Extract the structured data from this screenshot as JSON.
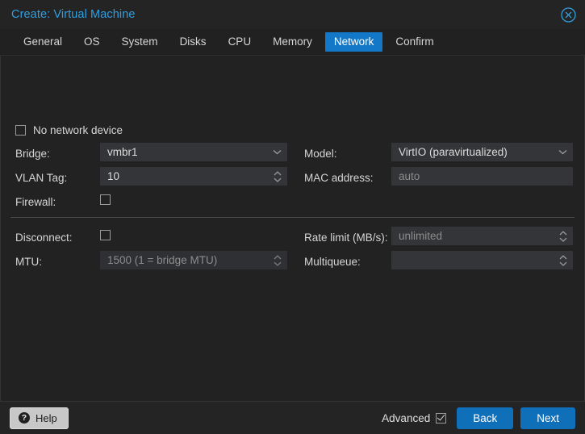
{
  "window": {
    "title": "Create: Virtual Machine",
    "close_icon": "close-circle-icon"
  },
  "tabs": [
    {
      "label": "General",
      "active": false
    },
    {
      "label": "OS",
      "active": false
    },
    {
      "label": "System",
      "active": false
    },
    {
      "label": "Disks",
      "active": false
    },
    {
      "label": "CPU",
      "active": false
    },
    {
      "label": "Memory",
      "active": false
    },
    {
      "label": "Network",
      "active": true
    },
    {
      "label": "Confirm",
      "active": false
    }
  ],
  "form": {
    "no_network_device": {
      "label": "No network device",
      "checked": false
    },
    "basic": [
      {
        "label": "Bridge:",
        "type": "select",
        "value": "vmbr1",
        "placeholder": false,
        "disabled": false,
        "icon": "chevron-down-icon",
        "name": "bridge"
      },
      {
        "label": "Model:",
        "type": "select",
        "value": "VirtIO (paravirtualized)",
        "placeholder": false,
        "disabled": false,
        "icon": "chevron-down-icon",
        "name": "model"
      },
      {
        "label": "VLAN Tag:",
        "type": "spinner",
        "value": "10",
        "placeholder": false,
        "disabled": false,
        "icon": "spinner-icon",
        "name": "vlan-tag"
      },
      {
        "label": "MAC address:",
        "type": "text",
        "value": "auto",
        "placeholder": true,
        "disabled": false,
        "icon": "",
        "name": "mac-address"
      },
      {
        "label": "Firewall:",
        "type": "checkbox",
        "checked": false,
        "name": "firewall"
      }
    ],
    "advanced": [
      {
        "label": "Disconnect:",
        "type": "checkbox",
        "checked": false,
        "name": "disconnect"
      },
      {
        "label": "Rate limit (MB/s):",
        "type": "spinner",
        "value": "unlimited",
        "placeholder": true,
        "disabled": false,
        "icon": "spinner-icon",
        "name": "rate-limit"
      },
      {
        "label": "MTU:",
        "type": "spinner",
        "value": "1500 (1 = bridge MTU)",
        "placeholder": true,
        "disabled": true,
        "icon": "spinner-icon",
        "name": "mtu"
      },
      {
        "label": "Multiqueue:",
        "type": "spinner",
        "value": "",
        "placeholder": false,
        "disabled": false,
        "icon": "spinner-icon",
        "name": "multiqueue"
      }
    ]
  },
  "footer": {
    "help_label": "Help",
    "help_icon": "question-mark-icon",
    "advanced_label": "Advanced",
    "advanced_checked": true,
    "back_label": "Back",
    "next_label": "Next"
  },
  "colors": {
    "accent": "#1478c8",
    "button_blue": "#0f6fb9",
    "title_blue": "#2f9fe0",
    "window_bg": "#212121",
    "field_bg": "#333538",
    "field_disabled_bg": "#2e3033"
  }
}
